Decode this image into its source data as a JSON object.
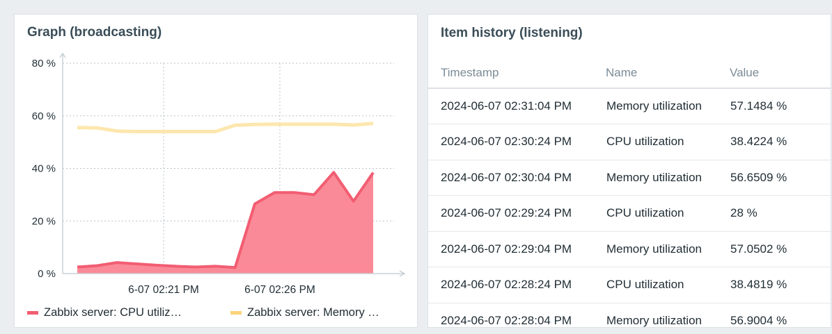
{
  "graph_widget": {
    "title": "Graph (broadcasting)",
    "legend": [
      {
        "label": "Zabbix server: CPU utiliz…",
        "color": "#f25d72"
      },
      {
        "label": "Zabbix server: Memory …",
        "color": "#fad37a"
      }
    ]
  },
  "chart_data": {
    "type": "area",
    "y_ticks": [
      "80 %",
      "60 %",
      "40 %",
      "20 %",
      "0 %"
    ],
    "x_ticks": [
      "6-07 02:21 PM",
      "6-07 02:26 PM"
    ],
    "ylim": [
      0,
      80
    ],
    "grid": true,
    "legend_placement": "bottom",
    "series": [
      {
        "name": "Zabbix server: CPU utiliz…",
        "color": "#f25d72",
        "fill": "#fa8a97",
        "values": [
          2.5,
          3,
          4.2,
          3.7,
          3.2,
          2.8,
          2.5,
          2.8,
          2.3,
          26.5,
          30.8,
          30.8,
          30,
          38.5,
          27.5,
          38.4
        ]
      },
      {
        "name": "Zabbix server: Memory …",
        "color": "#fde7ae",
        "values": [
          55.5,
          55.4,
          54.2,
          54,
          54,
          54,
          54,
          54,
          56.4,
          56.7,
          56.8,
          56.8,
          56.8,
          56.8,
          56.5,
          57.1
        ]
      }
    ]
  },
  "history_widget": {
    "title": "Item history (listening)",
    "columns": [
      "Timestamp",
      "Name",
      "Value"
    ],
    "rows": [
      [
        "2024-06-07 02:31:04 PM",
        "Memory utilization",
        "57.1484 %"
      ],
      [
        "2024-06-07 02:30:24 PM",
        "CPU utilization",
        "38.4224 %"
      ],
      [
        "2024-06-07 02:30:04 PM",
        "Memory utilization",
        "56.6509 %"
      ],
      [
        "2024-06-07 02:29:24 PM",
        "CPU utilization",
        "28 %"
      ],
      [
        "2024-06-07 02:29:04 PM",
        "Memory utilization",
        "57.0502 %"
      ],
      [
        "2024-06-07 02:28:24 PM",
        "CPU utilization",
        "38.4819 %"
      ],
      [
        "2024-06-07 02:28:04 PM",
        "Memory utilization",
        "56.9004 %"
      ]
    ]
  }
}
